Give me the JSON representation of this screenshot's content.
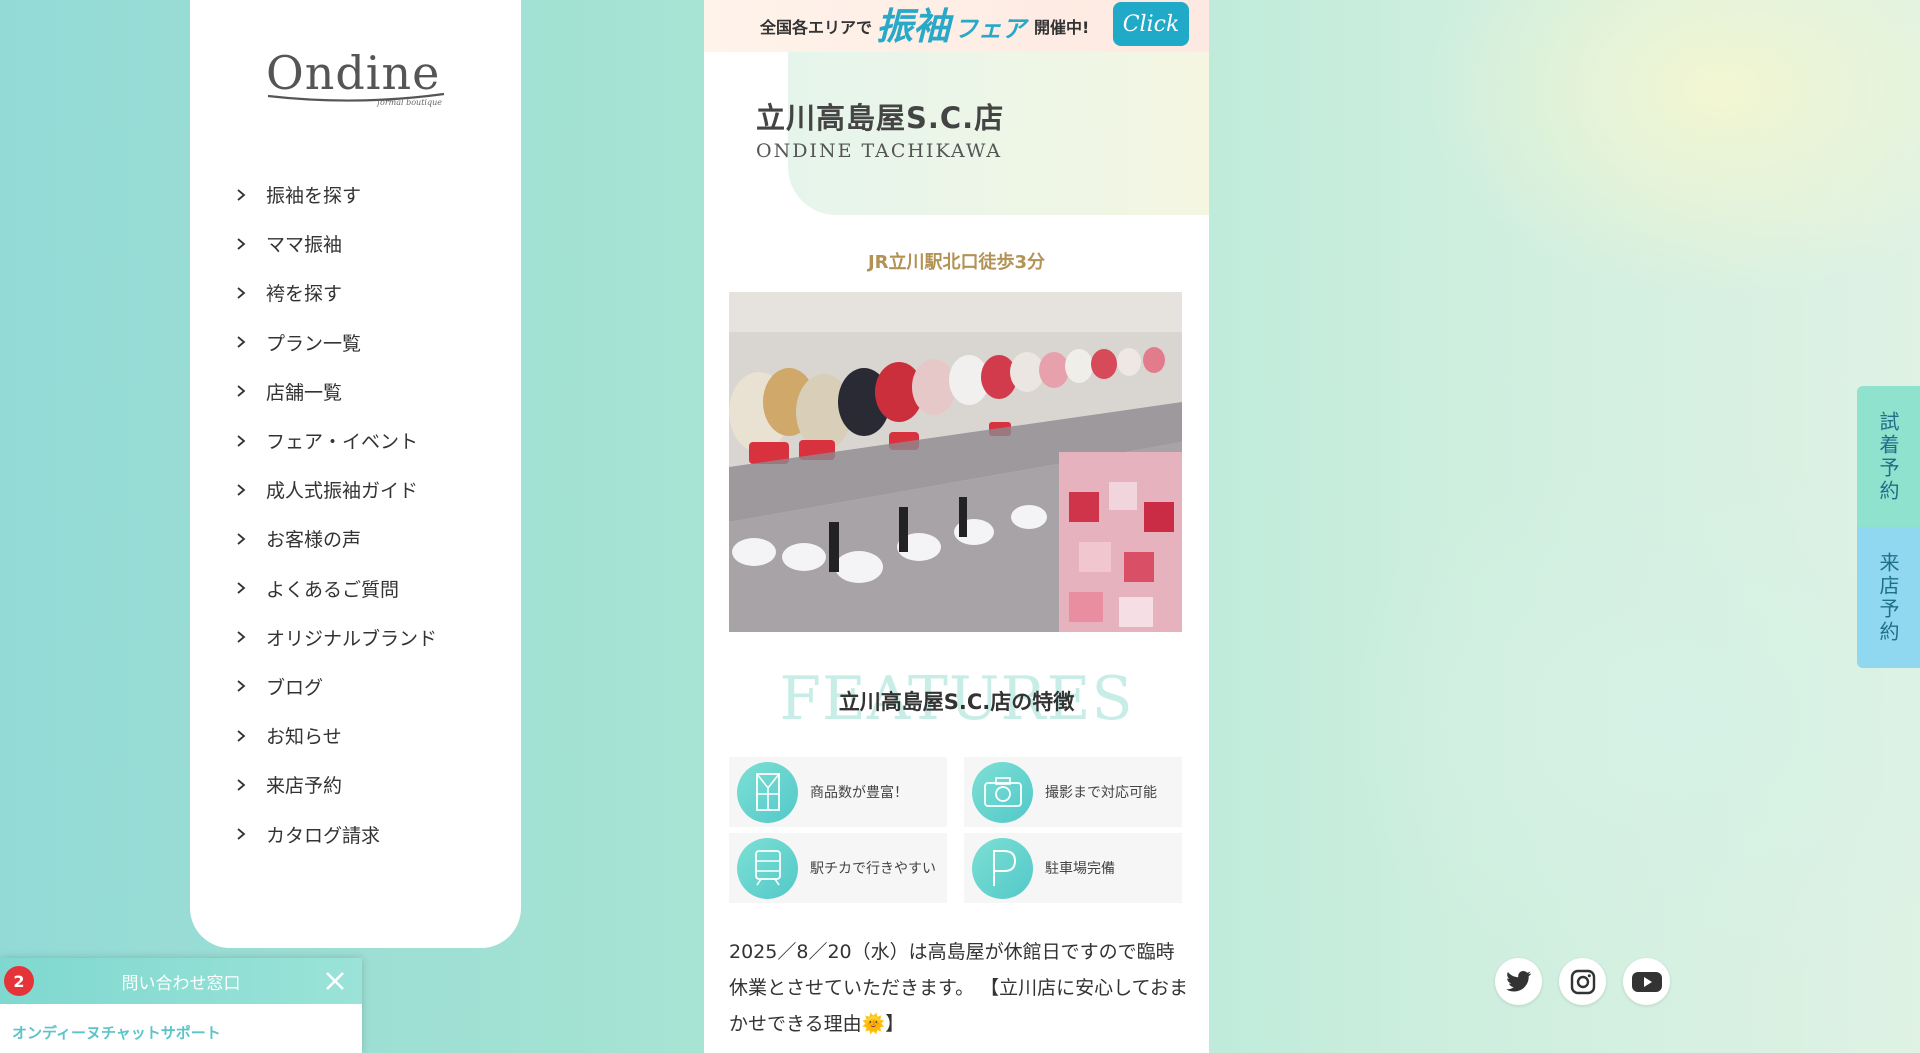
{
  "sidebar": {
    "logo_text": "Ondine",
    "logo_tagline": "formal boutique",
    "nav": [
      {
        "label": "振袖を探す"
      },
      {
        "label": "ママ振袖"
      },
      {
        "label": "袴を探す"
      },
      {
        "label": "プラン一覧"
      },
      {
        "label": "店舗一覧"
      },
      {
        "label": "フェア・イベント"
      },
      {
        "label": "成人式振袖ガイド"
      },
      {
        "label": "お客様の声"
      },
      {
        "label": "よくあるご質問"
      },
      {
        "label": "オリジナルブランド"
      },
      {
        "label": "ブログ"
      },
      {
        "label": "お知らせ"
      },
      {
        "label": "来店予約"
      },
      {
        "label": "カタログ請求"
      }
    ]
  },
  "banner": {
    "pre": "全国各エリアで",
    "big": "振袖",
    "fair": "フェア",
    "post": "開催中!",
    "click": "Click"
  },
  "store": {
    "title": "立川高島屋S.C.店",
    "subtitle": "ONDINE TACHIKAWA",
    "access": "JR立川駅北口徒歩3分"
  },
  "features": {
    "bg_word": "FEATURES",
    "title": "立川高島屋S.C.店の特徴",
    "items": [
      {
        "label": "商品数が豊富！",
        "icon": "kimono-icon"
      },
      {
        "label": "撮影まで対応可能",
        "icon": "camera-icon"
      },
      {
        "label": "駅チカで行きやすい",
        "icon": "train-icon"
      },
      {
        "label": "駐車場完備",
        "icon": "parking-icon"
      }
    ]
  },
  "notice": {
    "text": "2025／8／20（水）は高島屋が休館日ですので臨時休業とさせていただきます。 【立川店に安心しておまかせできる理由🌞】"
  },
  "side_tabs": {
    "fitting": "試着予約",
    "visit": "来店予約"
  },
  "social": [
    "twitter-icon",
    "instagram-icon",
    "youtube-icon"
  ],
  "chat": {
    "badge": "2",
    "title": "問い合わせ窓口",
    "subtitle": "オンディーヌチャットサポート"
  },
  "colors": {
    "accent": "#20aac7",
    "gold": "#b39256",
    "mint": "#8fe2cd",
    "sky": "#8fd8ef",
    "badge": "#e5333a"
  }
}
